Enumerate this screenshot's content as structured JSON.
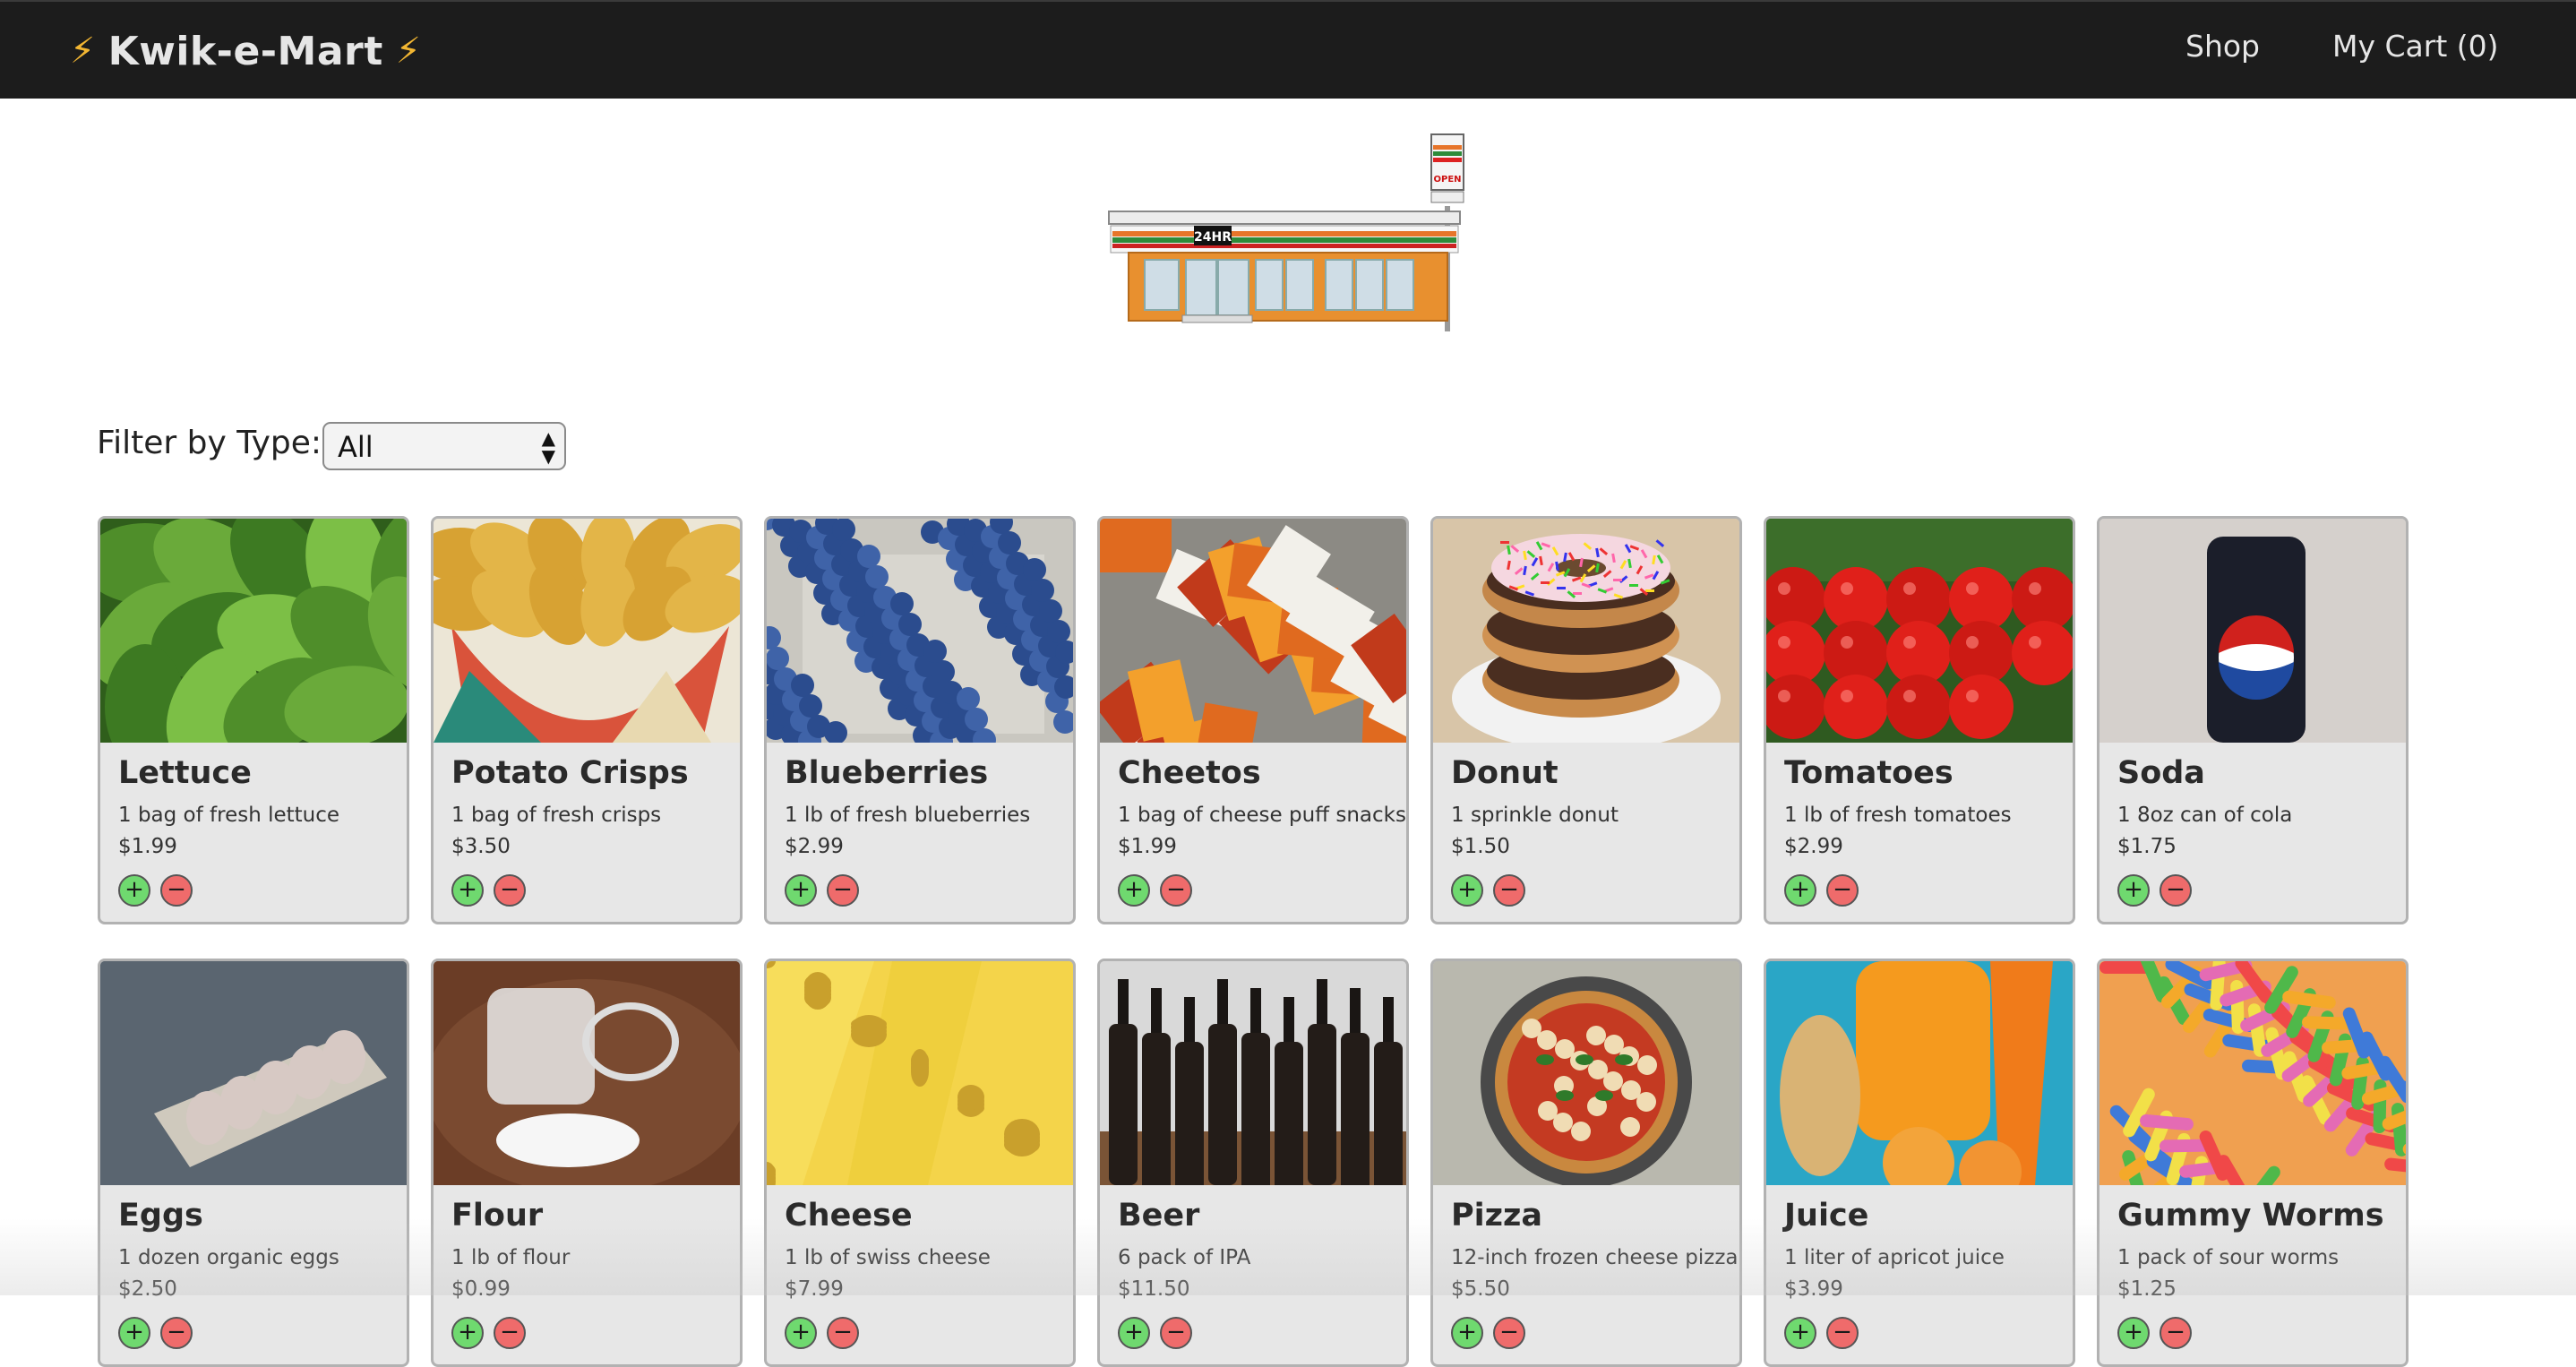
{
  "navbar": {
    "brand": "Kwik-e-Mart",
    "shop_label": "Shop",
    "cart_label": "My Cart (0)"
  },
  "store_sign": {
    "hours": "24HR",
    "open": "OPEN"
  },
  "filter": {
    "label": "Filter by Type:",
    "selected": "All"
  },
  "buttons": {
    "add": "+",
    "remove": "−"
  },
  "products": [
    {
      "name": "Lettuce",
      "desc": "1 bag of fresh lettuce",
      "price": "$1.99",
      "image": "lettuce"
    },
    {
      "name": "Potato Crisps",
      "desc": "1 bag of fresh crisps",
      "price": "$3.50",
      "image": "crisps"
    },
    {
      "name": "Blueberries",
      "desc": "1 lb of fresh blueberries",
      "price": "$2.99",
      "image": "blueberries"
    },
    {
      "name": "Cheetos",
      "desc": "1 bag of cheese puff snacks",
      "price": "$1.99",
      "image": "cheetos"
    },
    {
      "name": "Donut",
      "desc": "1 sprinkle donut",
      "price": "$1.50",
      "image": "donut"
    },
    {
      "name": "Tomatoes",
      "desc": "1 lb of fresh tomatoes",
      "price": "$2.99",
      "image": "tomatoes"
    },
    {
      "name": "Soda",
      "desc": "1 8oz can of cola",
      "price": "$1.75",
      "image": "soda"
    },
    {
      "name": "Eggs",
      "desc": "1 dozen organic eggs",
      "price": "$2.50",
      "image": "eggs"
    },
    {
      "name": "Flour",
      "desc": "1 lb of flour",
      "price": "$0.99",
      "image": "flour"
    },
    {
      "name": "Cheese",
      "desc": "1 lb of swiss cheese",
      "price": "$7.99",
      "image": "cheese"
    },
    {
      "name": "Beer",
      "desc": "6 pack of IPA",
      "price": "$11.50",
      "image": "beer"
    },
    {
      "name": "Pizza",
      "desc": "12-inch frozen cheese pizza",
      "price": "$5.50",
      "image": "pizza"
    },
    {
      "name": "Juice",
      "desc": "1 liter of apricot juice",
      "price": "$3.99",
      "image": "juice"
    },
    {
      "name": "Gummy Worms",
      "desc": "1 pack of sour worms",
      "price": "$1.25",
      "image": "gummies"
    }
  ]
}
